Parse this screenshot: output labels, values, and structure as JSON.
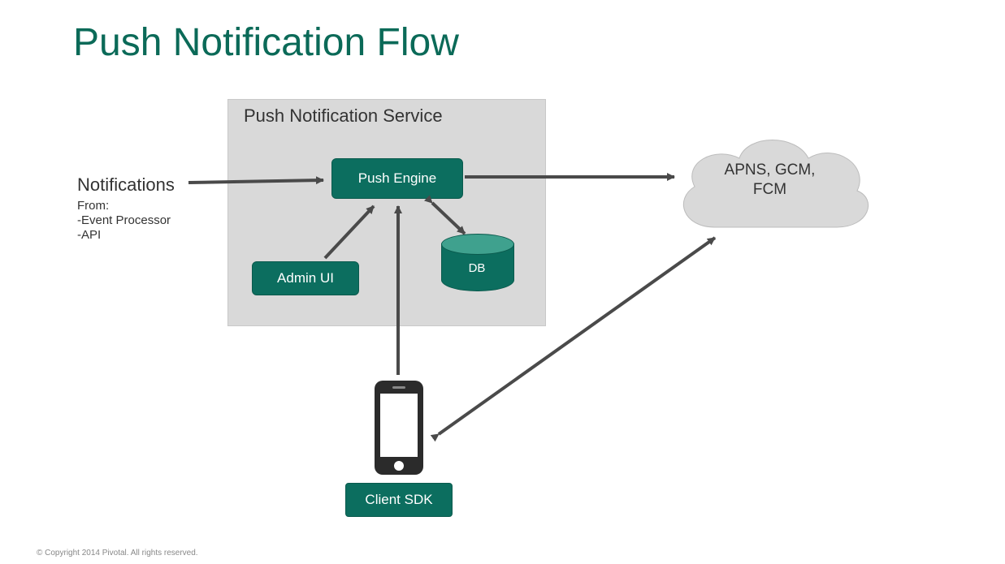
{
  "title": "Push Notification Flow",
  "service_label": "Push Notification Service",
  "notifications": {
    "label": "Notifications",
    "from": "From:",
    "line1": "-Event Processor",
    "line2": "-API"
  },
  "boxes": {
    "push_engine": "Push Engine",
    "admin_ui": "Admin UI",
    "db": "DB",
    "client_sdk": "Client SDK"
  },
  "cloud": {
    "line1": "APNS, GCM,",
    "line2": "FCM"
  },
  "copyright": "© Copyright 2014 Pivotal. All rights reserved.",
  "colors": {
    "title": "#0b6a58",
    "box_bg": "#0c6e5f",
    "service_bg": "#d9d9d9",
    "arrow": "#4a4a4a"
  }
}
